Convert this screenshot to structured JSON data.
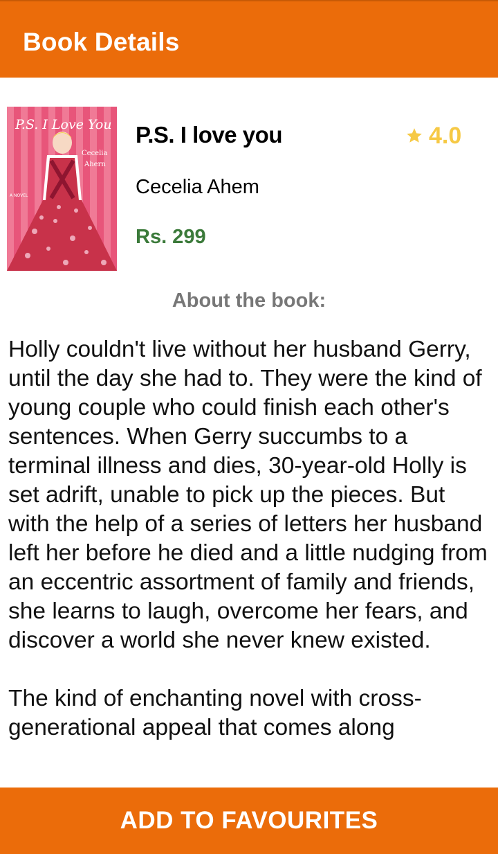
{
  "app_bar": {
    "title": "Book Details"
  },
  "book": {
    "title": "P.S. I love you",
    "rating": "4.0",
    "author": "Cecelia Ahem",
    "price": "Rs. 299",
    "cover": {
      "title_text": "P.S. I Love You",
      "author_line1": "Cecelia",
      "author_line2": "Ahern",
      "tag": "A NOVEL",
      "colors": {
        "background": "#E8557A",
        "dress": "#C8324A",
        "stripes": "#F07A96"
      }
    }
  },
  "about": {
    "heading": "About the book:",
    "paragraphs": [
      "Holly couldn't live without her husband Gerry, until the day she had to. They were the kind of young couple who could finish each other's sentences. When Gerry succumbs to a terminal illness and dies, 30-year-old Holly is set adrift, unable to pick up the pieces. But with the help of a series of letters her husband left her before he died and a little nudging from an eccentric assortment of family and friends, she learns to laugh, overcome her fears, and discover a world she never knew existed.",
      "The kind of enchanting novel with cross-generational appeal that comes along"
    ]
  },
  "actions": {
    "add_to_favourites": "ADD TO FAVOURITES"
  },
  "colors": {
    "primary": "#EB6C0A",
    "rating": "#F6C945",
    "price": "#3B7A3A",
    "heading_gray": "#777777"
  }
}
